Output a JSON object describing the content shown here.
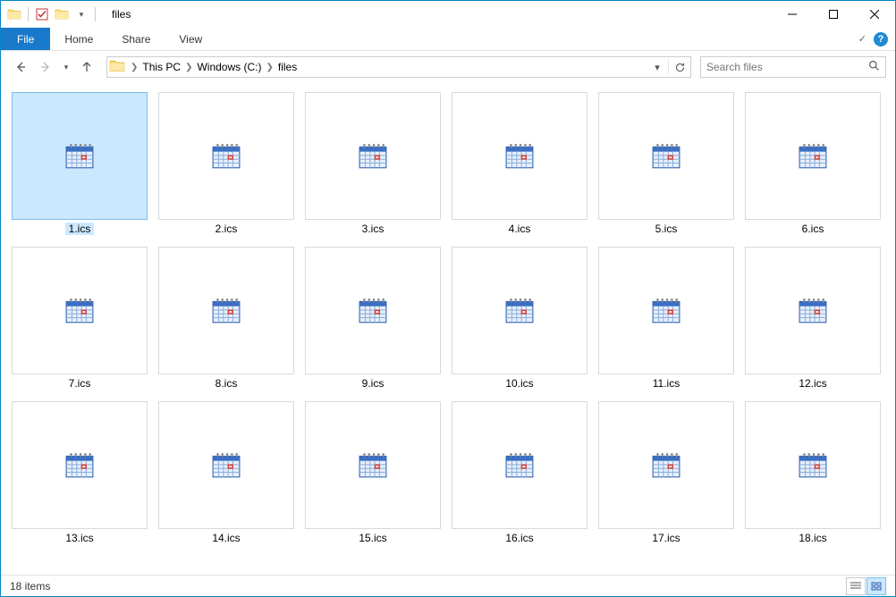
{
  "window": {
    "title": "files"
  },
  "ribbon": {
    "file": "File",
    "tabs": [
      "Home",
      "Share",
      "View"
    ]
  },
  "breadcrumbs": [
    "This PC",
    "Windows (C:)",
    "files"
  ],
  "search": {
    "placeholder": "Search files"
  },
  "files": [
    {
      "name": "1.ics",
      "selected": true
    },
    {
      "name": "2.ics"
    },
    {
      "name": "3.ics"
    },
    {
      "name": "4.ics"
    },
    {
      "name": "5.ics"
    },
    {
      "name": "6.ics"
    },
    {
      "name": "7.ics"
    },
    {
      "name": "8.ics"
    },
    {
      "name": "9.ics"
    },
    {
      "name": "10.ics"
    },
    {
      "name": "11.ics"
    },
    {
      "name": "12.ics"
    },
    {
      "name": "13.ics"
    },
    {
      "name": "14.ics"
    },
    {
      "name": "15.ics"
    },
    {
      "name": "16.ics"
    },
    {
      "name": "17.ics"
    },
    {
      "name": "18.ics"
    }
  ],
  "status": {
    "count": "18 items"
  }
}
